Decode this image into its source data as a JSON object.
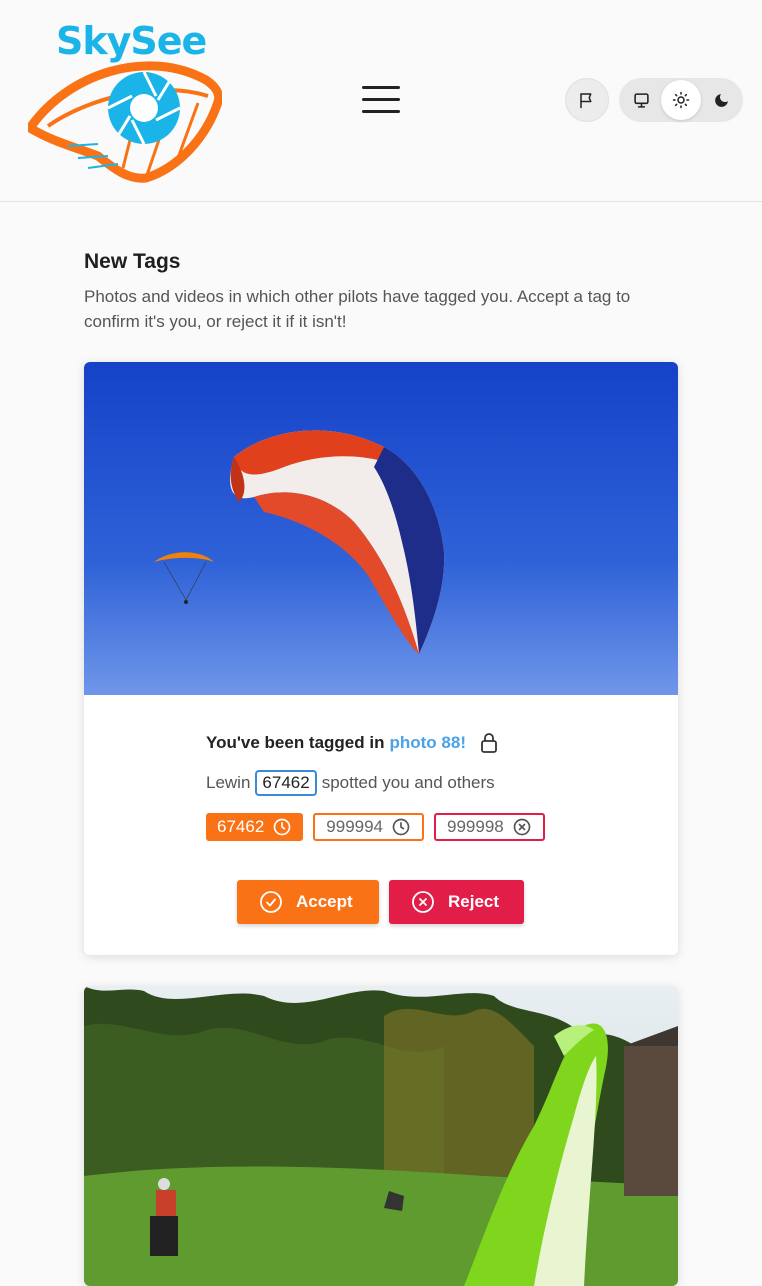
{
  "brand": {
    "name": "SkySee",
    "primary_color": "#f97316",
    "secondary_color": "#1ab4e8"
  },
  "header": {
    "menu_icon": "hamburger-icon",
    "report_icon": "flag-icon",
    "theme_options": [
      {
        "name": "system",
        "icon": "monitor-icon",
        "active": false
      },
      {
        "name": "light",
        "icon": "sun-icon",
        "active": true
      },
      {
        "name": "dark",
        "icon": "moon-icon",
        "active": false
      }
    ]
  },
  "page": {
    "title": "New Tags",
    "subtitle": "Photos and videos in which other pilots have tagged you. Accept a tag to confirm it's you, or reject it if it isn't!"
  },
  "tags": [
    {
      "tagged_prefix": "You've been tagged in",
      "link_text": "photo 88!",
      "private_icon": "lock-icon",
      "spotter_name": "Lewin",
      "spotter_id": "67462",
      "spotted_suffix": "spotted you and others",
      "chips": [
        {
          "label": "67462",
          "status": "pending",
          "icon": "clock-icon",
          "style": "filled"
        },
        {
          "label": "999994",
          "status": "pending",
          "icon": "clock-icon",
          "style": "outline"
        },
        {
          "label": "999998",
          "status": "rejected",
          "icon": "x-circle-icon",
          "style": "red"
        }
      ],
      "accept_label": "Accept",
      "reject_label": "Reject"
    }
  ]
}
